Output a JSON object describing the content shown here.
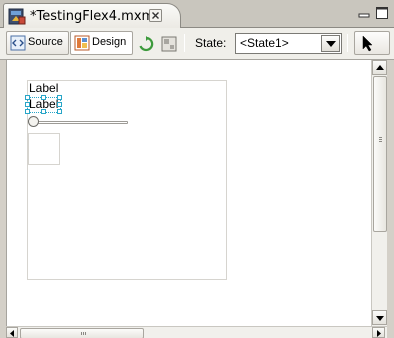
{
  "editor_tab": {
    "title": "*TestingFlex4.mxml",
    "icon": "mxml-file-icon",
    "close_icon": "close-icon"
  },
  "window_controls": [
    "minimize-icon",
    "maximize-icon"
  ],
  "toolbar": {
    "source_label": "Source",
    "design_label": "Design",
    "active_mode": "Design",
    "refresh_icon": "refresh-icon",
    "layout_icon": "constraints-icon",
    "state_label": "State:",
    "state_value": "<State1>",
    "select_tool_icon": "arrow-cursor-icon"
  },
  "canvas": {
    "label_1": "Label",
    "label_2": "Label",
    "selected_component": "label_2",
    "slider_value": 0
  },
  "colors": {
    "selection": "#29a6c8",
    "canvas_border": "#d6d4cf",
    "chrome": "#d4d0c8"
  }
}
